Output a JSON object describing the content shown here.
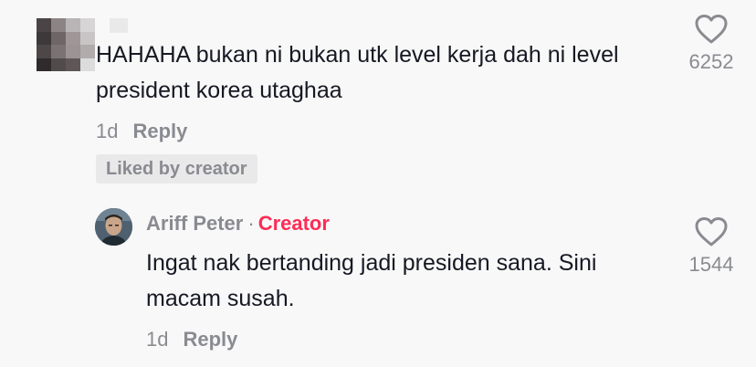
{
  "comments": {
    "top": {
      "text": "HAHAHA bukan ni bukan utk level kerja dah ni level president korea utaghaa",
      "time": "1d",
      "reply_label": "Reply",
      "liked_badge": "Liked by creator",
      "likes": "6252"
    },
    "reply": {
      "username": "Ariff Peter",
      "separator": "·",
      "role_badge": "Creator",
      "text": "Ingat nak bertanding jadi presiden sana. Sini macam susah.",
      "time": "1d",
      "reply_label": "Reply",
      "likes": "1544"
    }
  },
  "colors": {
    "background": "#f8f8f8",
    "text_primary": "#161823",
    "text_secondary": "#8a8b91",
    "creator_accent": "#fe2c55",
    "badge_background": "#e9e9ea"
  },
  "icons": {
    "like": "heart-outline-icon",
    "avatar_top": "pixelated-avatar",
    "avatar_reply": "user-avatar"
  }
}
